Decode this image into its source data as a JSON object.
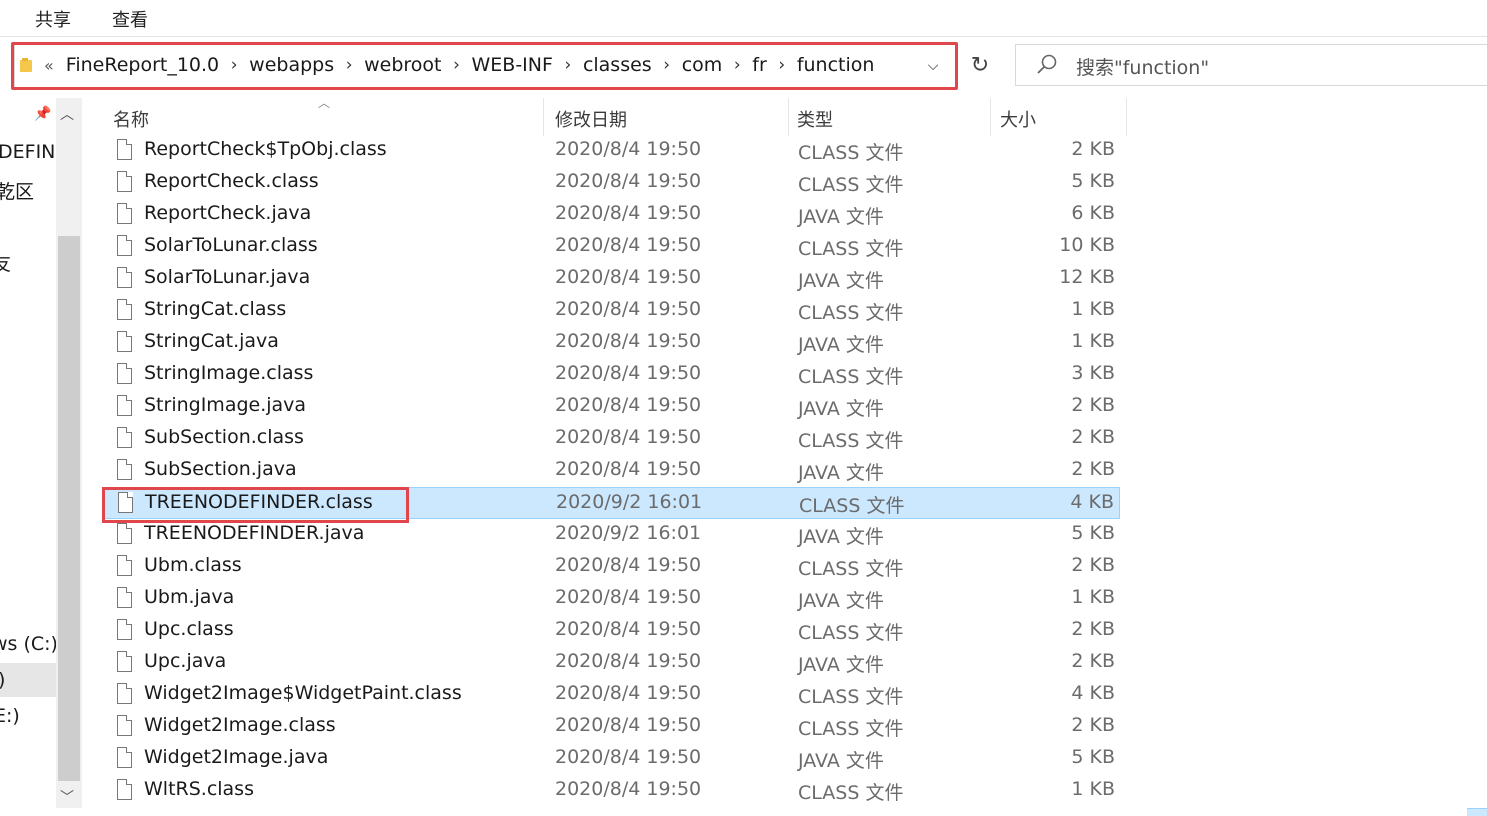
{
  "ribbon": {
    "tabs": [
      "共享",
      "查看"
    ]
  },
  "address": {
    "overflow": "«",
    "crumbs": [
      "FineReport_10.0",
      "webapps",
      "webroot",
      "WEB-INF",
      "classes",
      "com",
      "fr",
      "function"
    ],
    "separator": "›",
    "dropdown": "⌵",
    "refresh": "↻"
  },
  "search": {
    "placeholder": "搜索\"function\""
  },
  "nav": {
    "items": [
      "DEFIN",
      "乾区",
      "]",
      "友",
      "ws (C:)",
      ")",
      "E:)"
    ]
  },
  "columns": {
    "name": "名称",
    "date": "修改日期",
    "type": "类型",
    "size": "大小"
  },
  "files": [
    {
      "name": "ReportCheck$TpObj.class",
      "date": "2020/8/4 19:50",
      "type": "CLASS 文件",
      "size": "2 KB"
    },
    {
      "name": "ReportCheck.class",
      "date": "2020/8/4 19:50",
      "type": "CLASS 文件",
      "size": "5 KB"
    },
    {
      "name": "ReportCheck.java",
      "date": "2020/8/4 19:50",
      "type": "JAVA 文件",
      "size": "6 KB"
    },
    {
      "name": "SolarToLunar.class",
      "date": "2020/8/4 19:50",
      "type": "CLASS 文件",
      "size": "10 KB"
    },
    {
      "name": "SolarToLunar.java",
      "date": "2020/8/4 19:50",
      "type": "JAVA 文件",
      "size": "12 KB"
    },
    {
      "name": "StringCat.class",
      "date": "2020/8/4 19:50",
      "type": "CLASS 文件",
      "size": "1 KB"
    },
    {
      "name": "StringCat.java",
      "date": "2020/8/4 19:50",
      "type": "JAVA 文件",
      "size": "1 KB"
    },
    {
      "name": "StringImage.class",
      "date": "2020/8/4 19:50",
      "type": "CLASS 文件",
      "size": "3 KB"
    },
    {
      "name": "StringImage.java",
      "date": "2020/8/4 19:50",
      "type": "JAVA 文件",
      "size": "2 KB"
    },
    {
      "name": "SubSection.class",
      "date": "2020/8/4 19:50",
      "type": "CLASS 文件",
      "size": "2 KB"
    },
    {
      "name": "SubSection.java",
      "date": "2020/8/4 19:50",
      "type": "JAVA 文件",
      "size": "2 KB"
    },
    {
      "name": "TREENODEFINDER.class",
      "date": "2020/9/2 16:01",
      "type": "CLASS 文件",
      "size": "4 KB",
      "selected": true
    },
    {
      "name": "TREENODEFINDER.java",
      "date": "2020/9/2 16:01",
      "type": "JAVA 文件",
      "size": "5 KB"
    },
    {
      "name": "Ubm.class",
      "date": "2020/8/4 19:50",
      "type": "CLASS 文件",
      "size": "2 KB"
    },
    {
      "name": "Ubm.java",
      "date": "2020/8/4 19:50",
      "type": "JAVA 文件",
      "size": "1 KB"
    },
    {
      "name": "Upc.class",
      "date": "2020/8/4 19:50",
      "type": "CLASS 文件",
      "size": "2 KB"
    },
    {
      "name": "Upc.java",
      "date": "2020/8/4 19:50",
      "type": "JAVA 文件",
      "size": "2 KB"
    },
    {
      "name": "Widget2Image$WidgetPaint.class",
      "date": "2020/8/4 19:50",
      "type": "CLASS 文件",
      "size": "4 KB"
    },
    {
      "name": "Widget2Image.class",
      "date": "2020/8/4 19:50",
      "type": "CLASS 文件",
      "size": "2 KB"
    },
    {
      "name": "Widget2Image.java",
      "date": "2020/8/4 19:50",
      "type": "JAVA 文件",
      "size": "5 KB"
    },
    {
      "name": "WltRS.class",
      "date": "2020/8/4 19:50",
      "type": "CLASS 文件",
      "size": "1 KB"
    }
  ],
  "colors": {
    "selection": "#cce8ff",
    "highlight_box": "#e0474c"
  }
}
